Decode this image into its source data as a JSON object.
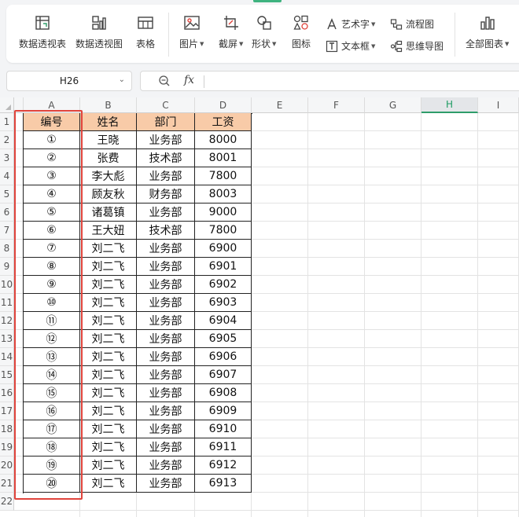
{
  "ribbon": {
    "buttons": [
      {
        "id": "pivot-table",
        "label": "数据透视表",
        "icon": "pivot-table-icon"
      },
      {
        "id": "pivot-chart",
        "label": "数据透视图",
        "icon": "pivot-chart-icon"
      },
      {
        "id": "table",
        "label": "表格",
        "icon": "table-icon"
      },
      {
        "id": "picture",
        "label": "图片",
        "icon": "picture-icon"
      },
      {
        "id": "screenshot",
        "label": "截屏",
        "icon": "screenshot-icon"
      },
      {
        "id": "shape",
        "label": "形状",
        "icon": "shape-icon"
      },
      {
        "id": "icon",
        "label": "图标",
        "icon": "icons-icon"
      },
      {
        "id": "all-charts",
        "label": "全部图表",
        "icon": "chart-icon"
      }
    ],
    "small_buttons": [
      {
        "id": "wordart",
        "label": "艺术字",
        "icon": "wordart-icon"
      },
      {
        "id": "textbox",
        "label": "文本框",
        "icon": "textbox-icon"
      },
      {
        "id": "flowchart",
        "label": "流程图",
        "icon": "flowchart-icon"
      },
      {
        "id": "mindmap",
        "label": "思维导图",
        "icon": "mindmap-icon"
      }
    ]
  },
  "formula_bar": {
    "cell_ref": "H26",
    "fx_label": "fx",
    "formula": ""
  },
  "grid": {
    "columns": [
      "A",
      "B",
      "C",
      "D",
      "E",
      "F",
      "G",
      "H",
      "I"
    ],
    "active_column": "H",
    "rows": [
      "1",
      "2",
      "3",
      "4",
      "5",
      "6",
      "7",
      "8",
      "9",
      "10",
      "11",
      "12",
      "13",
      "14",
      "15",
      "16",
      "17",
      "18",
      "19",
      "20",
      "21",
      "22"
    ],
    "table_headers": [
      "编号",
      "姓名",
      "部门",
      "工资"
    ],
    "table_rows": [
      [
        "①",
        "王晓",
        "业务部",
        "8000"
      ],
      [
        "②",
        "张费",
        "技术部",
        "8001"
      ],
      [
        "③",
        "李大彪",
        "业务部",
        "7800"
      ],
      [
        "④",
        "顾友秋",
        "财务部",
        "8003"
      ],
      [
        "⑤",
        "诸葛镇",
        "业务部",
        "9000"
      ],
      [
        "⑥",
        "王大妞",
        "技术部",
        "7800"
      ],
      [
        "⑦",
        "刘二飞",
        "业务部",
        "6900"
      ],
      [
        "⑧",
        "刘二飞",
        "业务部",
        "6901"
      ],
      [
        "⑨",
        "刘二飞",
        "业务部",
        "6902"
      ],
      [
        "⑩",
        "刘二飞",
        "业务部",
        "6903"
      ],
      [
        "⑪",
        "刘二飞",
        "业务部",
        "6904"
      ],
      [
        "⑫",
        "刘二飞",
        "业务部",
        "6905"
      ],
      [
        "⑬",
        "刘二飞",
        "业务部",
        "6906"
      ],
      [
        "⑭",
        "刘二飞",
        "业务部",
        "6907"
      ],
      [
        "⑮",
        "刘二飞",
        "业务部",
        "6908"
      ],
      [
        "⑯",
        "刘二飞",
        "业务部",
        "6909"
      ],
      [
        "⑰",
        "刘二飞",
        "业务部",
        "6910"
      ],
      [
        "⑱",
        "刘二飞",
        "业务部",
        "6911"
      ],
      [
        "⑲",
        "刘二飞",
        "业务部",
        "6912"
      ],
      [
        "⑳",
        "刘二飞",
        "业务部",
        "6913"
      ]
    ]
  },
  "colors": {
    "header_fill": "#f8cba8",
    "highlight_border": "#e0443c",
    "accent": "#2e9d6a"
  }
}
